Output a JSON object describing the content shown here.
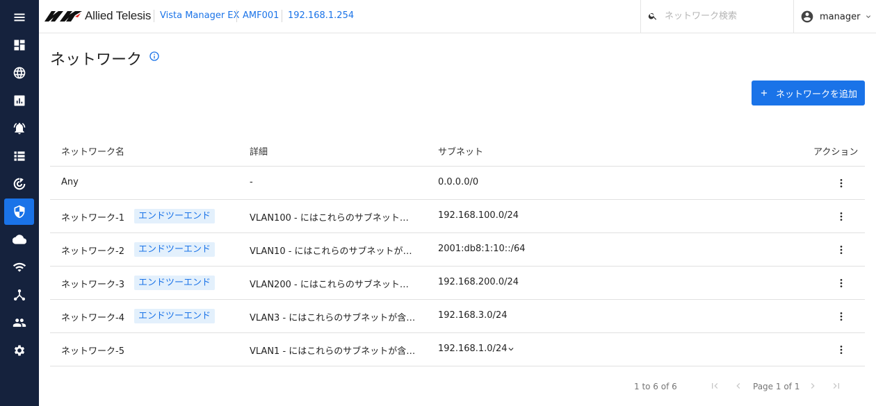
{
  "app": {
    "brand": "Allied Telesis",
    "breadcrumbs": [
      "Vista Manager EX",
      "AMF001",
      "192.168.1.254"
    ],
    "search_placeholder": "ネットワーク検索",
    "user": "manager",
    "accent_color": "#1a73e8",
    "rail_color": "#15223d"
  },
  "nav": {
    "items": [
      "menu-icon",
      "dashboard-icon",
      "globe-icon",
      "chart-icon",
      "alarm-icon",
      "list-icon",
      "radar-icon",
      "shield-icon",
      "cloud-icon",
      "wifi-icon",
      "topology-icon",
      "people-icon",
      "gear-icon"
    ],
    "active": "shield-icon"
  },
  "page": {
    "title": "ネットワーク",
    "add_button": "ネットワークを追加"
  },
  "table": {
    "headers": {
      "name": "ネットワーク名",
      "detail": "詳細",
      "subnet": "サブネット",
      "action": "アクション"
    },
    "rows": [
      {
        "name": "Any",
        "badge": "",
        "detail": "-",
        "subnet": "0.0.0.0/0"
      },
      {
        "name": "ネットワーク-1",
        "badge": "エンドツーエンド",
        "detail": "VLAN100 - にはこれらのサブネットが…",
        "subnet": "192.168.100.0/24"
      },
      {
        "name": "ネットワーク-2",
        "badge": "エンドツーエンド",
        "detail": "VLAN10 - にはこれらのサブネットが含…",
        "subnet": "2001:db8:1:10::/64"
      },
      {
        "name": "ネットワーク-3",
        "badge": "エンドツーエンド",
        "detail": "VLAN200 - にはこれらのサブネットが…",
        "subnet": "192.168.200.0/24"
      },
      {
        "name": "ネットワーク-4",
        "badge": "エンドツーエンド",
        "detail": "VLAN3 - にはこれらのサブネットが含…",
        "subnet": "192.168.3.0/24"
      },
      {
        "name": "ネットワーク-5",
        "badge": "",
        "detail": "VLAN1 - にはこれらのサブネットが含…",
        "subnet": "192.168.1.0/24"
      }
    ]
  },
  "pagination": {
    "count": "1 to 6 of 6",
    "page": "Page 1 of 1"
  }
}
